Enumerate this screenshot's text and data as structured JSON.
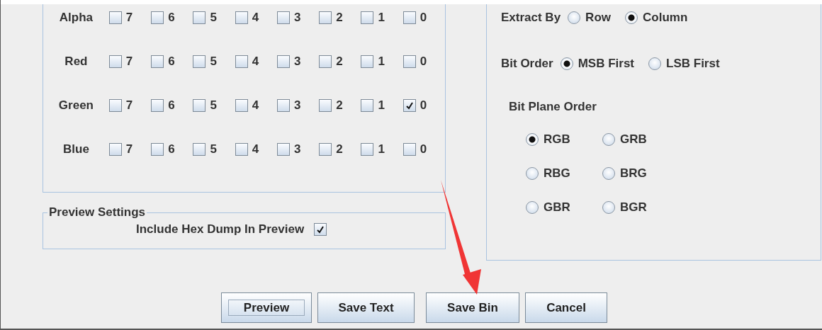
{
  "bit_planes": [
    {
      "name": "Alpha",
      "bits": [
        {
          "label": "7",
          "checked": false
        },
        {
          "label": "6",
          "checked": false
        },
        {
          "label": "5",
          "checked": false
        },
        {
          "label": "4",
          "checked": false
        },
        {
          "label": "3",
          "checked": false
        },
        {
          "label": "2",
          "checked": false
        },
        {
          "label": "1",
          "checked": false
        },
        {
          "label": "0",
          "checked": false
        }
      ]
    },
    {
      "name": "Red",
      "bits": [
        {
          "label": "7",
          "checked": false
        },
        {
          "label": "6",
          "checked": false
        },
        {
          "label": "5",
          "checked": false
        },
        {
          "label": "4",
          "checked": false
        },
        {
          "label": "3",
          "checked": false
        },
        {
          "label": "2",
          "checked": false
        },
        {
          "label": "1",
          "checked": false
        },
        {
          "label": "0",
          "checked": false
        }
      ]
    },
    {
      "name": "Green",
      "bits": [
        {
          "label": "7",
          "checked": false
        },
        {
          "label": "6",
          "checked": false
        },
        {
          "label": "5",
          "checked": false
        },
        {
          "label": "4",
          "checked": false
        },
        {
          "label": "3",
          "checked": false
        },
        {
          "label": "2",
          "checked": false
        },
        {
          "label": "1",
          "checked": false
        },
        {
          "label": "0",
          "checked": true
        }
      ]
    },
    {
      "name": "Blue",
      "bits": [
        {
          "label": "7",
          "checked": false
        },
        {
          "label": "6",
          "checked": false
        },
        {
          "label": "5",
          "checked": false
        },
        {
          "label": "4",
          "checked": false
        },
        {
          "label": "3",
          "checked": false
        },
        {
          "label": "2",
          "checked": false
        },
        {
          "label": "1",
          "checked": false
        },
        {
          "label": "0",
          "checked": false
        }
      ]
    }
  ],
  "preview_settings": {
    "title": "Preview Settings",
    "option": "Include Hex Dump In Preview",
    "checked": true
  },
  "order_settings": {
    "extract_by": {
      "label": "Extract By",
      "options": [
        {
          "label": "Row",
          "selected": false
        },
        {
          "label": "Column",
          "selected": true
        }
      ]
    },
    "bit_order": {
      "label": "Bit Order",
      "options": [
        {
          "label": "MSB First",
          "selected": true
        },
        {
          "label": "LSB First",
          "selected": false
        }
      ]
    },
    "bit_plane_order": {
      "label": "Bit Plane Order",
      "options": [
        {
          "label": "RGB",
          "selected": true
        },
        {
          "label": "GRB",
          "selected": false
        },
        {
          "label": "RBG",
          "selected": false
        },
        {
          "label": "BRG",
          "selected": false
        },
        {
          "label": "GBR",
          "selected": false
        },
        {
          "label": "BGR",
          "selected": false
        }
      ]
    }
  },
  "buttons": [
    {
      "label": "Preview",
      "focused": true
    },
    {
      "label": "Save Text",
      "focused": false
    },
    {
      "label": "Save Bin",
      "focused": false
    },
    {
      "label": "Cancel",
      "focused": false
    }
  ]
}
